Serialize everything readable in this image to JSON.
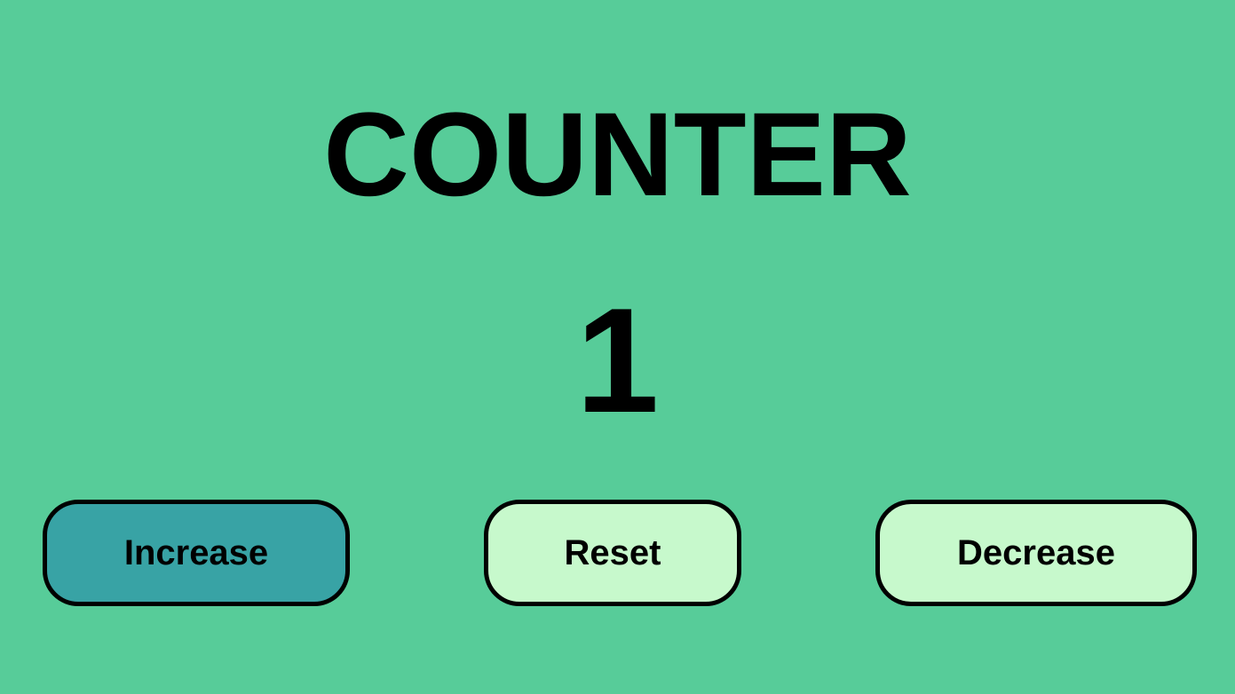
{
  "counter": {
    "title": "COUNTER",
    "value": "1"
  },
  "buttons": {
    "increase_label": "Increase",
    "reset_label": "Reset",
    "decrease_label": "Decrease"
  },
  "colors": {
    "background": "#57cc99",
    "active_button": "#38a3a5",
    "button": "#c7f9cc",
    "text": "#000000"
  }
}
